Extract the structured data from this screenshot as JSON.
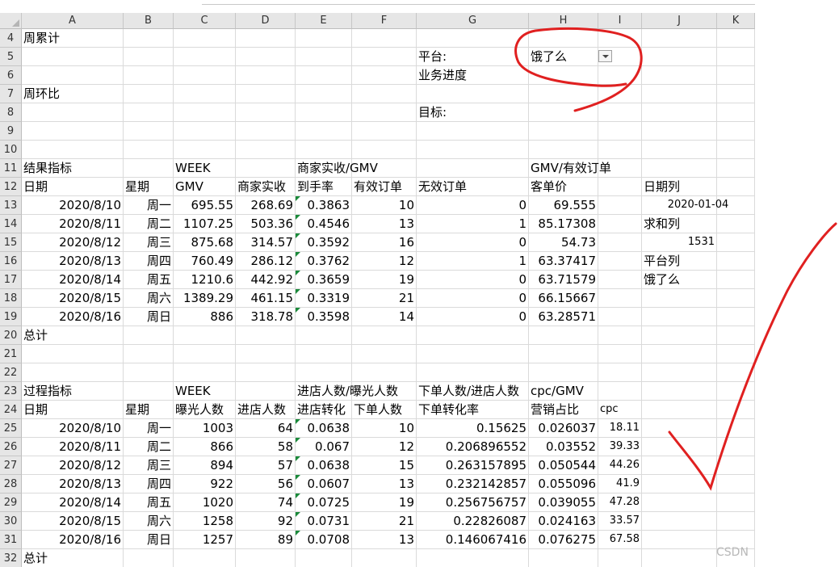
{
  "columns": [
    "A",
    "B",
    "C",
    "D",
    "E",
    "F",
    "G",
    "H",
    "I",
    "J",
    "K"
  ],
  "rows": [
    4,
    5,
    6,
    7,
    8,
    9,
    10,
    11,
    12,
    13,
    14,
    15,
    16,
    17,
    18,
    19,
    20,
    21,
    22,
    23,
    24,
    25,
    26,
    27,
    28,
    29,
    30,
    31,
    32
  ],
  "header_section": {
    "week_cumulative": "周累计",
    "week_on_week": "周环比",
    "platform_label": "平台:",
    "platform_value": "饿了么",
    "business_progress": "业务进度",
    "target_label": "目标:"
  },
  "result_table": {
    "section_title": "结果指标",
    "group_week": "WEEK",
    "group_ratio": "商家实收/GMV",
    "group_aov": "GMV/有效订单",
    "headers": [
      "日期",
      "星期",
      "GMV",
      "商家实收",
      "到手率",
      "有效订单",
      "无效订单",
      "客单价"
    ],
    "rows": [
      [
        "2020/8/10",
        "周一",
        "695.55",
        "268.69",
        "0.3863",
        "10",
        "0",
        "69.555"
      ],
      [
        "2020/8/11",
        "周二",
        "1107.25",
        "503.36",
        "0.4546",
        "13",
        "1",
        "85.17308"
      ],
      [
        "2020/8/12",
        "周三",
        "875.68",
        "314.57",
        "0.3592",
        "16",
        "0",
        "54.73"
      ],
      [
        "2020/8/13",
        "周四",
        "760.49",
        "286.12",
        "0.3762",
        "12",
        "1",
        "63.37417"
      ],
      [
        "2020/8/14",
        "周五",
        "1210.6",
        "442.92",
        "0.3659",
        "19",
        "0",
        "63.71579"
      ],
      [
        "2020/8/15",
        "周六",
        "1389.29",
        "461.15",
        "0.3319",
        "21",
        "0",
        "66.15667"
      ],
      [
        "2020/8/16",
        "周日",
        "886",
        "318.78",
        "0.3598",
        "14",
        "0",
        "63.28571"
      ]
    ],
    "total_label": "总计"
  },
  "side_panel": {
    "date_col_label": "日期列",
    "date_value": "2020-01-04",
    "sum_col_label": "求和列",
    "sum_value": "1531",
    "platform_col_label": "平台列",
    "platform_value": "饿了么"
  },
  "process_table": {
    "section_title": "过程指标",
    "group_week": "WEEK",
    "group_visit": "进店人数/曝光人数",
    "group_order": "下单人数/进店人数",
    "group_cpc": "cpc/GMV",
    "headers": [
      "日期",
      "星期",
      "曝光人数",
      "进店人数",
      "进店转化",
      "下单人数",
      "下单转化率",
      "营销占比",
      "cpc"
    ],
    "rows": [
      [
        "2020/8/10",
        "周一",
        "1003",
        "64",
        "0.0638",
        "10",
        "0.15625",
        "0.026037",
        "18.11"
      ],
      [
        "2020/8/11",
        "周二",
        "866",
        "58",
        "0.067",
        "12",
        "0.206896552",
        "0.03552",
        "39.33"
      ],
      [
        "2020/8/12",
        "周三",
        "894",
        "57",
        "0.0638",
        "15",
        "0.263157895",
        "0.050544",
        "44.26"
      ],
      [
        "2020/8/13",
        "周四",
        "922",
        "56",
        "0.0607",
        "13",
        "0.232142857",
        "0.055096",
        "41.9"
      ],
      [
        "2020/8/14",
        "周五",
        "1020",
        "74",
        "0.0725",
        "19",
        "0.256756757",
        "0.039055",
        "47.28"
      ],
      [
        "2020/8/15",
        "周六",
        "1258",
        "92",
        "0.0731",
        "21",
        "0.22826087",
        "0.024163",
        "33.57"
      ],
      [
        "2020/8/16",
        "周日",
        "1257",
        "89",
        "0.0708",
        "13",
        "0.146067416",
        "0.076275",
        "67.58"
      ]
    ],
    "total_label": "总计"
  },
  "watermark": "CSDN",
  "colors": {
    "annotation_red": "#e02020",
    "error_triangle": "#1a8a3a",
    "header_bg": "#e6e6e6",
    "grid": "#dadada"
  }
}
